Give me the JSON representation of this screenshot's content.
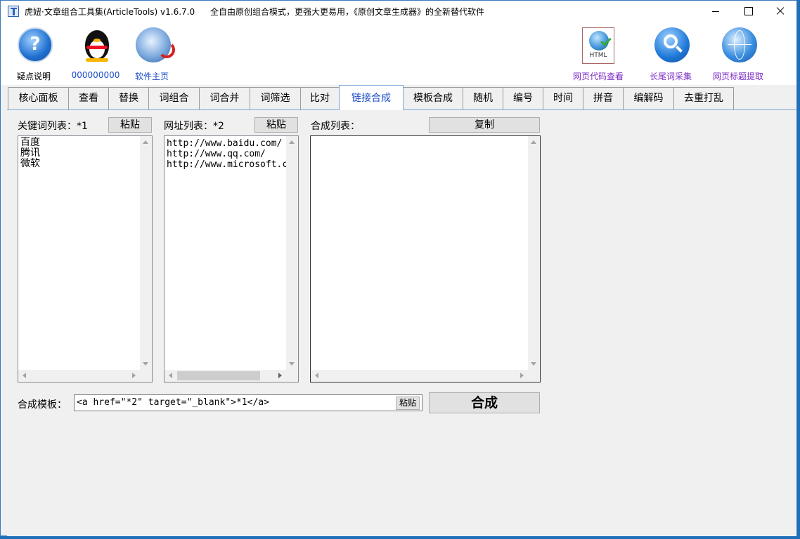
{
  "window": {
    "title": "虎妞·文章组合工具集(ArticleTools) v1.6.7.0",
    "slogan": "全自由原创组合模式，更强大更易用，《原创文章生成器》的全新替代软件"
  },
  "toolbar": {
    "left": [
      {
        "label": "疑点说明",
        "icon": "help-icon"
      },
      {
        "label": "000000000",
        "icon": "qq-penguin-icon"
      },
      {
        "label": "软件主页",
        "icon": "globe-icon"
      }
    ],
    "right": [
      {
        "label": "网页代码查看",
        "icon": "html-document-icon"
      },
      {
        "label": "长尾词采集",
        "icon": "search-icon"
      },
      {
        "label": "网页标题提取",
        "icon": "globe-icon"
      }
    ],
    "html_icon_text": "HTML"
  },
  "tabs": [
    "核心面板",
    "查看",
    "替换",
    "词组合",
    "词合并",
    "词筛选",
    "比对",
    "链接合成",
    "模板合成",
    "随机",
    "编号",
    "时间",
    "拼音",
    "编解码",
    "去重打乱"
  ],
  "active_tab": "链接合成",
  "panel": {
    "keyword_label": "关键词列表：*1",
    "keyword_paste": "粘贴",
    "keywords": [
      "百度",
      "腾讯",
      "微软"
    ],
    "url_label": "网址列表：*2",
    "url_paste": "粘贴",
    "urls": [
      "http://www.baidu.com/",
      "http://www.qq.com/",
      "http://www.microsoft.c"
    ],
    "result_label": "合成列表：",
    "copy_button": "复制",
    "template_label": "合成模板：",
    "template_value": "<a href=\"*2\" target=\"_blank\">*1</a>",
    "template_paste": "粘贴",
    "compose_button": "合成"
  }
}
